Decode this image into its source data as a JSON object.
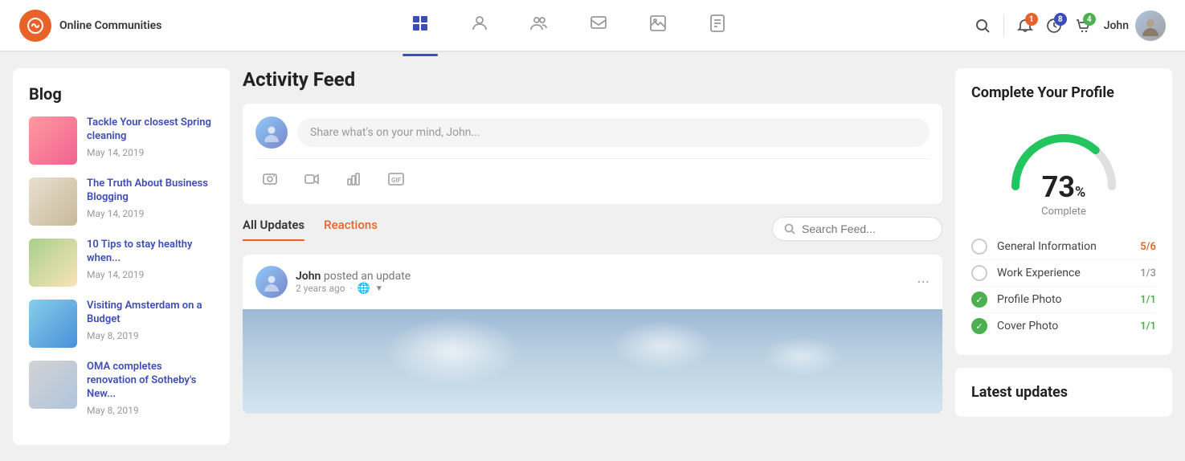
{
  "app": {
    "name": "Online Communities"
  },
  "navbar": {
    "logo_symbol": "b",
    "title_line1": "Online",
    "title_line2": "Communities",
    "nav_items": [
      {
        "id": "home",
        "icon": "➕",
        "active": true
      },
      {
        "id": "profile",
        "icon": "👤",
        "active": false
      },
      {
        "id": "groups",
        "icon": "👥",
        "active": false
      },
      {
        "id": "messages",
        "icon": "💬",
        "active": false
      },
      {
        "id": "media",
        "icon": "📷",
        "active": false
      },
      {
        "id": "notes",
        "icon": "📋",
        "active": false
      }
    ],
    "notifications_badge": "1",
    "activity_badge": "8",
    "cart_badge": "4",
    "user_name": "John"
  },
  "sidebar": {
    "title": "Blog",
    "items": [
      {
        "title": "Tackle Your closest Spring cleaning",
        "date": "May 14, 2019",
        "thumb_class": "thumb-1"
      },
      {
        "title": "The Truth About Business Blogging",
        "date": "May 14, 2019",
        "thumb_class": "thumb-2"
      },
      {
        "title": "10 Tips to stay healthy when...",
        "date": "May 14, 2019",
        "thumb_class": "thumb-3"
      },
      {
        "title": "Visiting Amsterdam on a Budget",
        "date": "May 8, 2019",
        "thumb_class": "thumb-4"
      },
      {
        "title": "OMA completes renovation of Sotheby's New...",
        "date": "May 8, 2019",
        "thumb_class": "thumb-5"
      }
    ]
  },
  "feed": {
    "title": "Activity Feed",
    "post_placeholder": "Share what's on your mind, John...",
    "tabs": [
      {
        "label": "All Updates",
        "active": true
      },
      {
        "label": "Reactions",
        "active": false
      }
    ],
    "search_placeholder": "Search Feed...",
    "post": {
      "user_name": "John",
      "action": "posted an update",
      "time": "2 years ago"
    }
  },
  "profile_complete": {
    "title": "Complete Your Profile",
    "percent": "73",
    "percent_symbol": "%",
    "complete_label": "Complete",
    "items": [
      {
        "label": "General Information",
        "count": "5/6",
        "done": false,
        "color": "orange"
      },
      {
        "label": "Work Experience",
        "count": "1/3",
        "done": false,
        "color": "gray"
      },
      {
        "label": "Profile Photo",
        "count": "1/1",
        "done": true,
        "color": "green"
      },
      {
        "label": "Cover Photo",
        "count": "1/1",
        "done": true,
        "color": "green"
      }
    ]
  },
  "latest_updates": {
    "title": "Latest updates"
  }
}
